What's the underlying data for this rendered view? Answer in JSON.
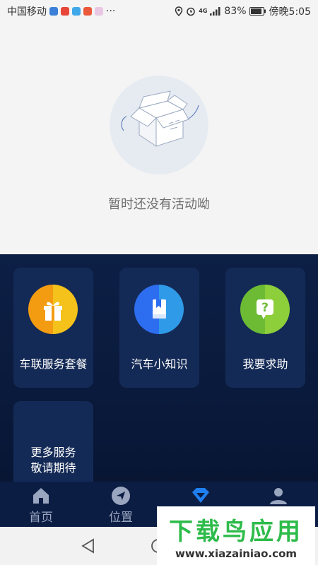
{
  "status_bar": {
    "carrier": "中国移动",
    "network": "4G",
    "battery": "83%",
    "time": "傍晚5:05",
    "more": "···"
  },
  "empty_state": {
    "message": "暂时还没有活动呦"
  },
  "services": [
    {
      "label": "车联服务套餐",
      "icon": "gift-icon"
    },
    {
      "label": "汽车小知识",
      "icon": "book-icon"
    },
    {
      "label": "我要求助",
      "icon": "help-icon"
    }
  ],
  "more_services": {
    "line1": "更多服务",
    "line2": "敬请期待"
  },
  "tabs": [
    {
      "label": "首页",
      "icon": "home-icon"
    },
    {
      "label": "位置",
      "icon": "location-icon"
    },
    {
      "label": "",
      "icon": "diamond-icon"
    },
    {
      "label": "",
      "icon": "user-icon"
    }
  ],
  "watermark": {
    "title": "下载鸟应用",
    "url": "www.xiazainiao.com"
  },
  "colors": {
    "accent": "#2f8cf0",
    "services_bg": "#0c1f45",
    "card_bg": "#142a56",
    "tab_active": "#1f7ff0"
  }
}
